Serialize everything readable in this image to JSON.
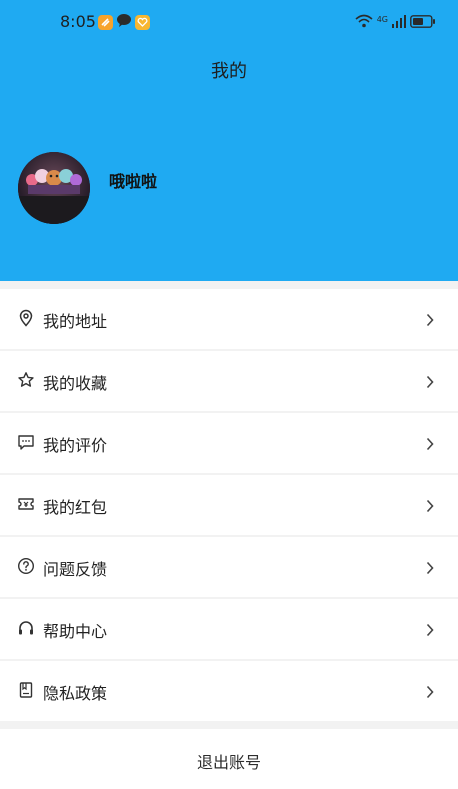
{
  "status_bar": {
    "time": "8:05",
    "network": "4G",
    "left_icons": [
      "app-orange-icon",
      "chat-bubble-icon",
      "heart-badge-icon"
    ],
    "right_icons": [
      "wifi-icon",
      "signal-icon",
      "battery-icon"
    ]
  },
  "header": {
    "title": "我的",
    "username": "哦啦啦",
    "background": "#1faaf2"
  },
  "menu": {
    "items": [
      {
        "label": "我的地址",
        "icon": "location-pin-icon"
      },
      {
        "label": "我的收藏",
        "icon": "star-icon"
      },
      {
        "label": "我的评价",
        "icon": "comment-icon"
      },
      {
        "label": "我的红包",
        "icon": "ticket-icon"
      },
      {
        "label": "问题反馈",
        "icon": "question-circle-icon"
      },
      {
        "label": "帮助中心",
        "icon": "headphones-icon"
      },
      {
        "label": "隐私政策",
        "icon": "document-icon"
      }
    ]
  },
  "logout": {
    "label": "退出账号"
  }
}
